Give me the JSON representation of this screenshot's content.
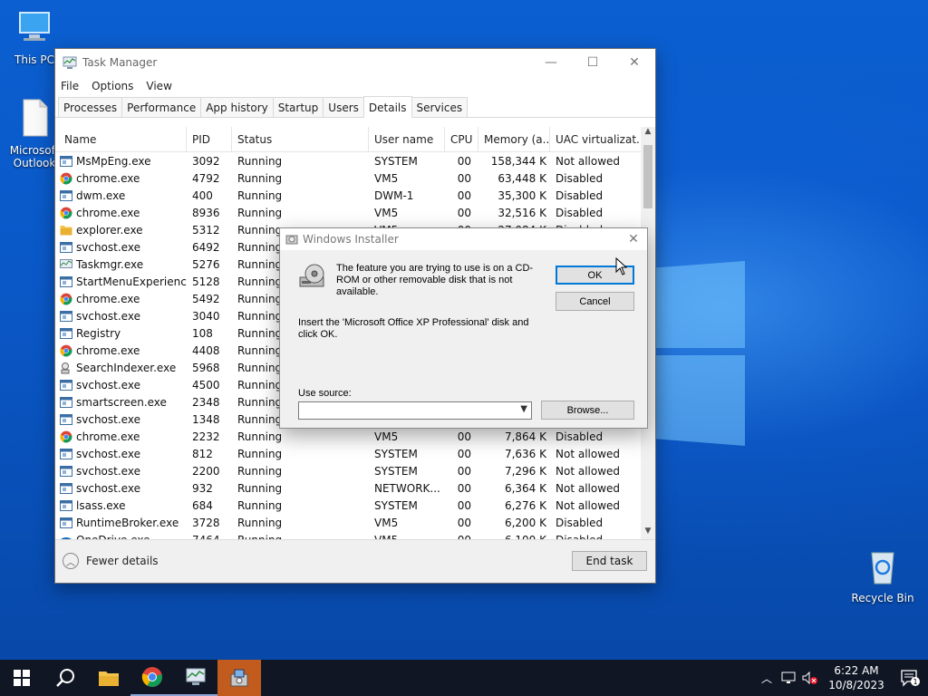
{
  "desktop": {
    "icons": [
      {
        "label": "This PC"
      },
      {
        "label": "Microsoft Outlook"
      },
      {
        "label": "Recycle Bin"
      }
    ]
  },
  "task_manager": {
    "title": "Task Manager",
    "menu": [
      "File",
      "Options",
      "View"
    ],
    "tabs": [
      "Processes",
      "Performance",
      "App history",
      "Startup",
      "Users",
      "Details",
      "Services"
    ],
    "active_tab": "Details",
    "columns": [
      "Name",
      "PID",
      "Status",
      "User name",
      "CPU",
      "Memory (a...",
      "UAC virtualizat..."
    ],
    "rows": [
      {
        "icon": "service",
        "name": "MsMpEng.exe",
        "pid": "3092",
        "status": "Running",
        "user": "SYSTEM",
        "cpu": "00",
        "mem": "158,344 K",
        "uac": "Not allowed"
      },
      {
        "icon": "chrome",
        "name": "chrome.exe",
        "pid": "4792",
        "status": "Running",
        "user": "VM5",
        "cpu": "00",
        "mem": "63,448 K",
        "uac": "Disabled"
      },
      {
        "icon": "service",
        "name": "dwm.exe",
        "pid": "400",
        "status": "Running",
        "user": "DWM-1",
        "cpu": "00",
        "mem": "35,300 K",
        "uac": "Disabled"
      },
      {
        "icon": "chrome",
        "name": "chrome.exe",
        "pid": "8936",
        "status": "Running",
        "user": "VM5",
        "cpu": "00",
        "mem": "32,516 K",
        "uac": "Disabled"
      },
      {
        "icon": "folder",
        "name": "explorer.exe",
        "pid": "5312",
        "status": "Running",
        "user": "VM5",
        "cpu": "00",
        "mem": "27,084 K",
        "uac": "Disabled"
      },
      {
        "icon": "service",
        "name": "svchost.exe",
        "pid": "6492",
        "status": "Running",
        "user": "",
        "cpu": "",
        "mem": "",
        "uac": ""
      },
      {
        "icon": "taskmgr",
        "name": "Taskmgr.exe",
        "pid": "5276",
        "status": "Running",
        "user": "",
        "cpu": "",
        "mem": "",
        "uac": ""
      },
      {
        "icon": "service",
        "name": "StartMenuExperienc...",
        "pid": "5128",
        "status": "Running",
        "user": "",
        "cpu": "",
        "mem": "",
        "uac": ""
      },
      {
        "icon": "chrome",
        "name": "chrome.exe",
        "pid": "5492",
        "status": "Running",
        "user": "",
        "cpu": "",
        "mem": "",
        "uac": ""
      },
      {
        "icon": "service",
        "name": "svchost.exe",
        "pid": "3040",
        "status": "Running",
        "user": "",
        "cpu": "",
        "mem": "",
        "uac": ""
      },
      {
        "icon": "service",
        "name": "Registry",
        "pid": "108",
        "status": "Running",
        "user": "",
        "cpu": "",
        "mem": "",
        "uac": ""
      },
      {
        "icon": "chrome",
        "name": "chrome.exe",
        "pid": "4408",
        "status": "Running",
        "user": "",
        "cpu": "",
        "mem": "",
        "uac": ""
      },
      {
        "icon": "search",
        "name": "SearchIndexer.exe",
        "pid": "5968",
        "status": "Running",
        "user": "",
        "cpu": "",
        "mem": "",
        "uac": ""
      },
      {
        "icon": "service",
        "name": "svchost.exe",
        "pid": "4500",
        "status": "Running",
        "user": "",
        "cpu": "",
        "mem": "",
        "uac": ""
      },
      {
        "icon": "service",
        "name": "smartscreen.exe",
        "pid": "2348",
        "status": "Running",
        "user": "",
        "cpu": "",
        "mem": "",
        "uac": ""
      },
      {
        "icon": "service",
        "name": "svchost.exe",
        "pid": "1348",
        "status": "Running",
        "user": "",
        "cpu": "",
        "mem": "",
        "uac": ""
      },
      {
        "icon": "chrome",
        "name": "chrome.exe",
        "pid": "2232",
        "status": "Running",
        "user": "VM5",
        "cpu": "00",
        "mem": "7,864 K",
        "uac": "Disabled"
      },
      {
        "icon": "service",
        "name": "svchost.exe",
        "pid": "812",
        "status": "Running",
        "user": "SYSTEM",
        "cpu": "00",
        "mem": "7,636 K",
        "uac": "Not allowed"
      },
      {
        "icon": "service",
        "name": "svchost.exe",
        "pid": "2200",
        "status": "Running",
        "user": "SYSTEM",
        "cpu": "00",
        "mem": "7,296 K",
        "uac": "Not allowed"
      },
      {
        "icon": "service",
        "name": "svchost.exe",
        "pid": "932",
        "status": "Running",
        "user": "NETWORK...",
        "cpu": "00",
        "mem": "6,364 K",
        "uac": "Not allowed"
      },
      {
        "icon": "service",
        "name": "lsass.exe",
        "pid": "684",
        "status": "Running",
        "user": "SYSTEM",
        "cpu": "00",
        "mem": "6,276 K",
        "uac": "Not allowed"
      },
      {
        "icon": "service",
        "name": "RuntimeBroker.exe",
        "pid": "3728",
        "status": "Running",
        "user": "VM5",
        "cpu": "00",
        "mem": "6,200 K",
        "uac": "Disabled"
      },
      {
        "icon": "onedrive",
        "name": "OneDrive.exe",
        "pid": "7464",
        "status": "Running",
        "user": "VM5",
        "cpu": "00",
        "mem": "6,100 K",
        "uac": "Disabled"
      }
    ],
    "fewer_details": "Fewer details",
    "end_task": "End task"
  },
  "installer_dialog": {
    "title": "Windows Installer",
    "message": "The feature you are trying to use is on a CD-ROM or other removable disk that is not available.",
    "instruction": "Insert the 'Microsoft Office XP Professional' disk and click OK.",
    "ok_label": "OK",
    "cancel_label": "Cancel",
    "use_source_label": "Use source:",
    "source_value": "",
    "browse_label": "Browse..."
  },
  "taskbar": {
    "items": [
      "start-icon",
      "search-icon",
      "file-explorer-icon",
      "chrome-icon",
      "task-manager-icon",
      "installer-icon"
    ],
    "time": "6:22 AM",
    "date": "10/8/2023",
    "notification_count": "1"
  },
  "colors": {
    "accent": "#0078d7",
    "taskbar": "#101624",
    "active_task": "#c25b1e"
  }
}
